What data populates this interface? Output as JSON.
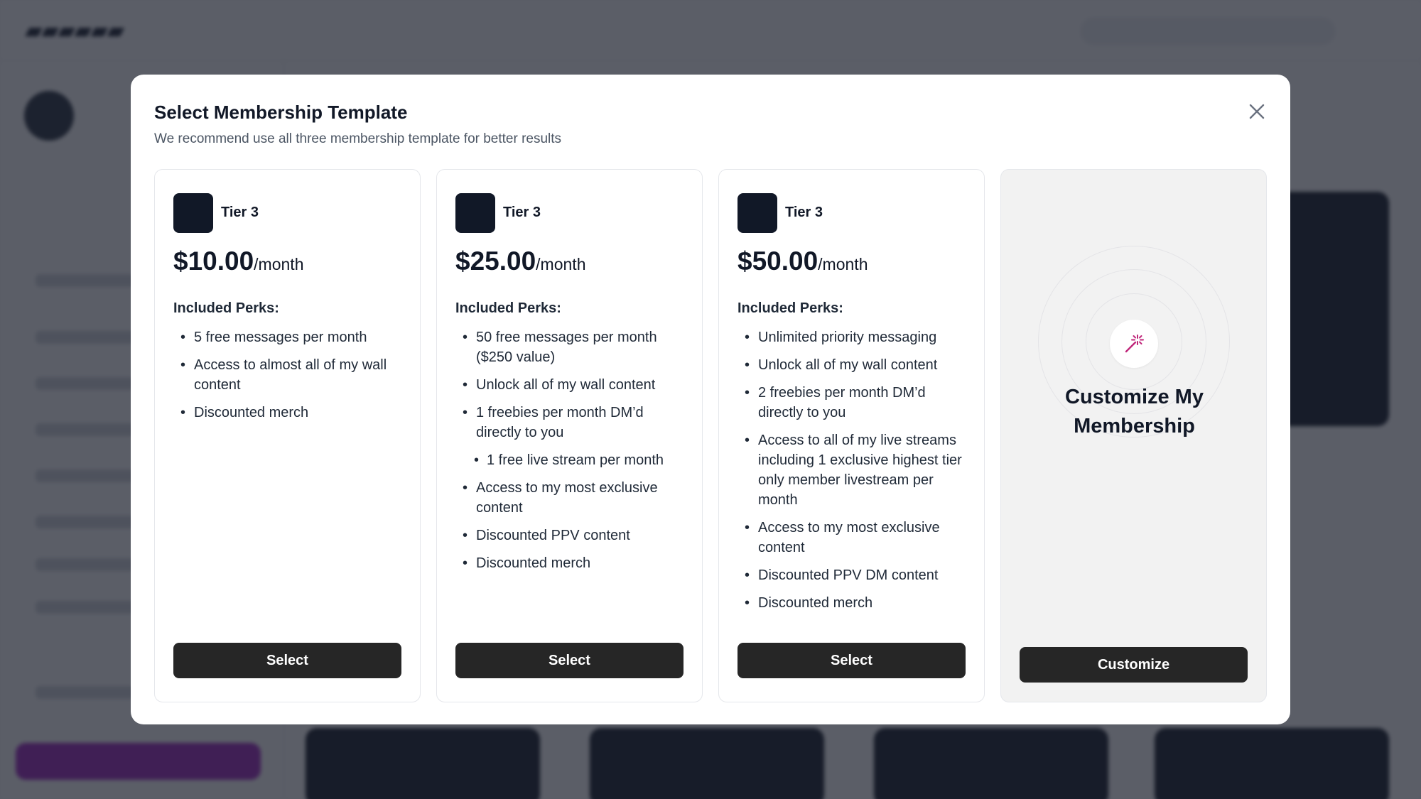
{
  "modal": {
    "title": "Select Membership Template",
    "subtitle": "We recommend use all three membership template for better results",
    "close_icon": "close-icon"
  },
  "tiers": [
    {
      "name": "Tier 3",
      "price": "$10.00",
      "period": "/month",
      "perks_title": "Included Perks:",
      "perks": [
        "5 free messages per month",
        "Access to almost all of my wall content",
        "Discounted merch"
      ],
      "button": "Select"
    },
    {
      "name": "Tier 3",
      "price": "$25.00",
      "period": "/month",
      "perks_title": "Included Perks:",
      "perks": [
        "50 free messages per month ($250 value)",
        "Unlock all of my wall content",
        "1 freebies per month DM’d directly to you",
        "1 free live stream per month",
        "Access to my most exclusive content",
        "Discounted PPV content",
        "Discounted merch"
      ],
      "button": "Select"
    },
    {
      "name": "Tier 3",
      "price": "$50.00",
      "period": "/month",
      "perks_title": "Included Perks:",
      "perks": [
        "Unlimited priority messaging",
        "Unlock all of my wall content",
        "2 freebies per month DM’d directly to you",
        "Access to all of my live streams including 1 exclusive highest tier only member livestream per month",
        "Access to my most exclusive content",
        "Discounted PPV DM content",
        "Discounted merch"
      ],
      "button": "Select"
    }
  ],
  "custom": {
    "title_line1": "Customize My",
    "title_line2": "Membership",
    "icon": "magic-wand-icon",
    "button": "Customize"
  },
  "colors": {
    "overlay": "#1c202c",
    "button": "#262626",
    "wand_accent": "#c0267a",
    "cta_purple": "#9d1fbf"
  }
}
